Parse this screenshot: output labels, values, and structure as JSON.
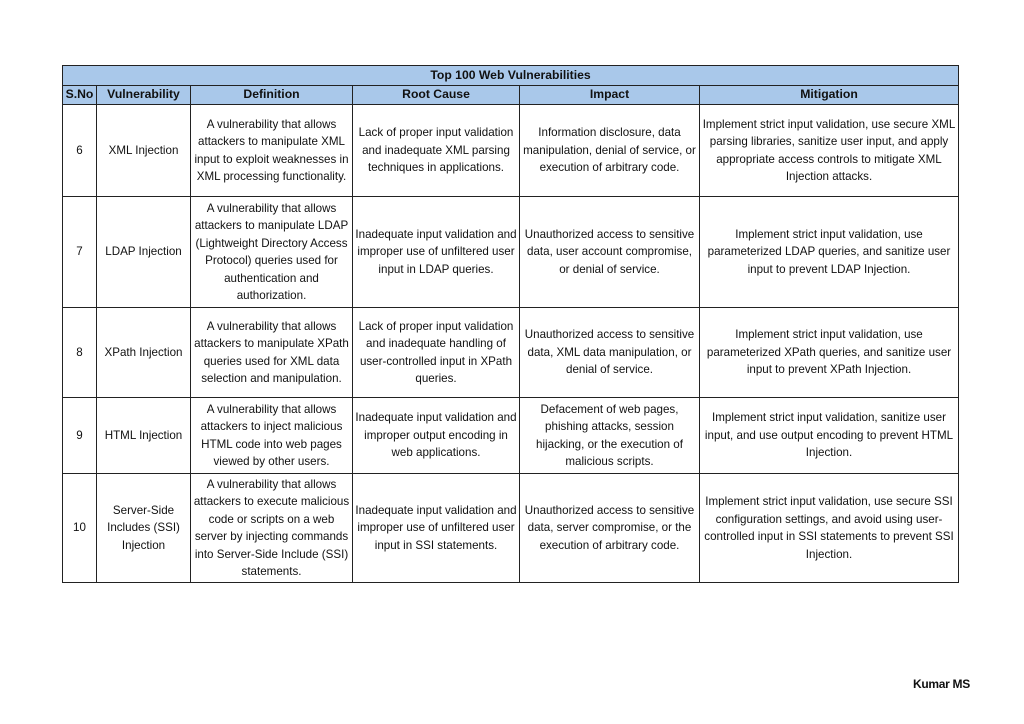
{
  "table": {
    "title": "Top 100  Web Vulnerabilities",
    "header_color": "#a9c8ea",
    "columns": [
      "S.No",
      "Vulnerability",
      "Definition",
      "Root Cause",
      "Impact",
      "Mitigation"
    ],
    "rows": [
      {
        "sno": "6",
        "vulnerability": "XML Injection",
        "definition": "A vulnerability that allows attackers to manipulate XML input to exploit weaknesses in XML processing functionality.",
        "root_cause": "Lack of proper input validation and inadequate XML parsing techniques in applications.",
        "impact": "Information disclosure, data manipulation, denial of service, or execution of arbitrary code.",
        "mitigation": "Implement strict input validation, use secure XML parsing libraries, sanitize user input, and apply appropriate access controls to mitigate XML Injection attacks."
      },
      {
        "sno": "7",
        "vulnerability": "LDAP Injection",
        "definition": "A vulnerability that allows attackers to manipulate LDAP (Lightweight Directory Access Protocol) queries used for authentication and authorization.",
        "root_cause": "Inadequate input validation and improper use of unfiltered user input in LDAP queries.",
        "impact": "Unauthorized access to sensitive data, user account compromise, or denial of service.",
        "mitigation": "Implement strict input validation, use parameterized LDAP queries, and sanitize user input to prevent LDAP Injection."
      },
      {
        "sno": "8",
        "vulnerability": "XPath Injection",
        "definition": "A vulnerability that allows attackers to manipulate XPath queries used for XML data selection and manipulation.",
        "root_cause": "Lack of proper input validation and inadequate handling of user-controlled input in XPath queries.",
        "impact": "Unauthorized access to sensitive data, XML data manipulation, or denial of service.",
        "mitigation": "Implement strict input validation, use parameterized XPath queries, and sanitize user input to prevent XPath Injection."
      },
      {
        "sno": "9",
        "vulnerability": "HTML Injection",
        "definition": "A vulnerability that allows attackers to inject malicious HTML code into web pages viewed by other users.",
        "root_cause": "Inadequate input validation and improper output encoding in web applications.",
        "impact": "Defacement of web pages, phishing attacks, session hijacking, or the execution of malicious scripts.",
        "mitigation": "Implement strict input validation, sanitize user input, and use output encoding to prevent HTML Injection."
      },
      {
        "sno": "10",
        "vulnerability": "Server-Side Includes (SSI) Injection",
        "definition": "A vulnerability that allows attackers to execute malicious code or scripts on a web server by injecting commands into Server-Side Include (SSI) statements.",
        "root_cause": "Inadequate input validation and improper use of unfiltered user input in SSI statements.",
        "impact": "Unauthorized access to sensitive data, server compromise, or the execution of arbitrary code.",
        "mitigation": "Implement strict input validation, use secure SSI configuration settings, and avoid using user-controlled input in SSI statements to prevent SSI Injection."
      }
    ]
  },
  "footer": {
    "author": "Kumar MS"
  }
}
